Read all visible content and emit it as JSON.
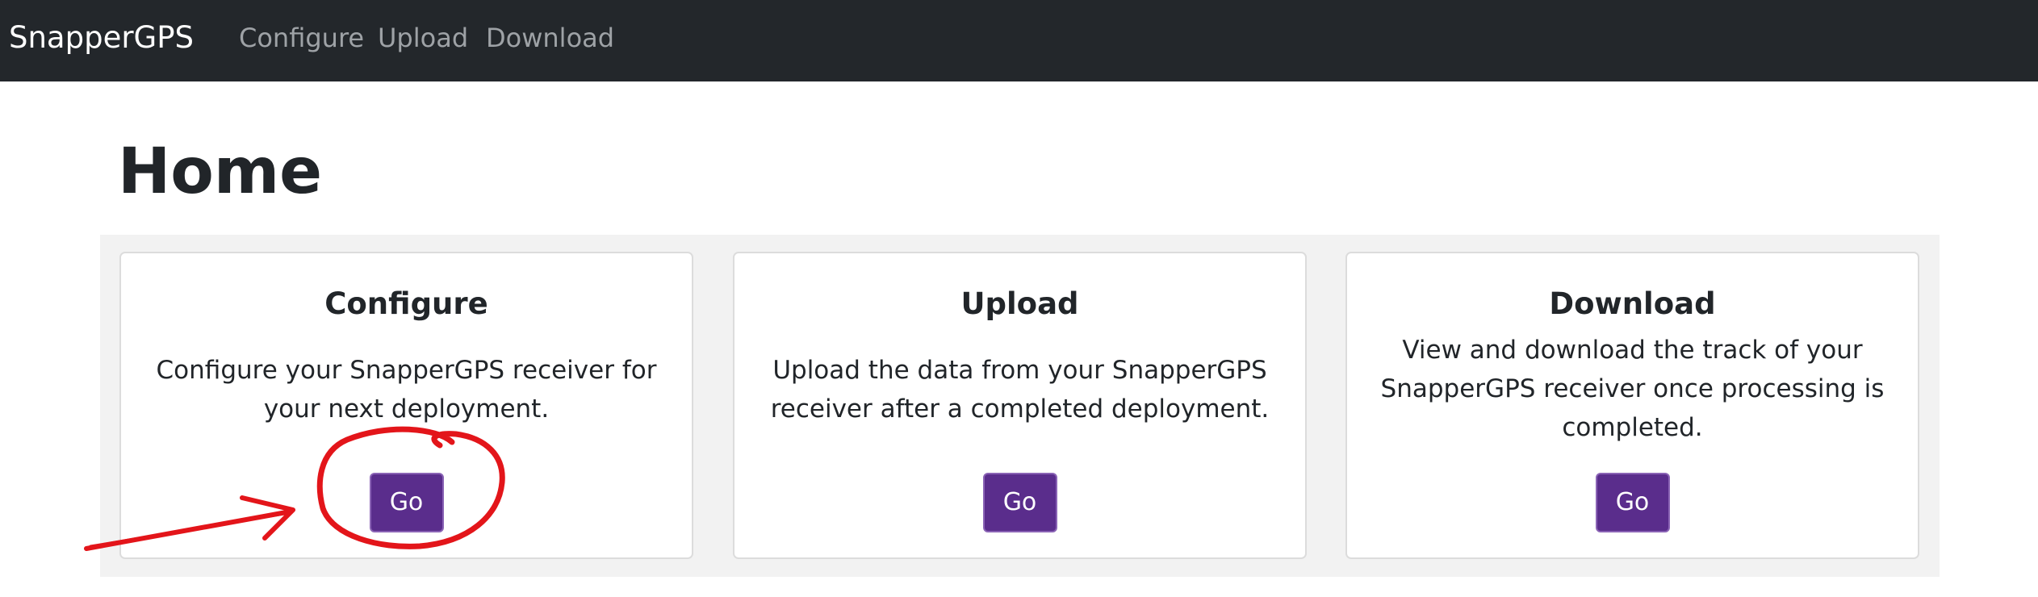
{
  "navbar": {
    "brand": "SnapperGPS",
    "links": [
      {
        "label": "Configure"
      },
      {
        "label": "Upload"
      },
      {
        "label": "Download"
      }
    ]
  },
  "page": {
    "title": "Home"
  },
  "cards": [
    {
      "title": "Configure",
      "text": "Configure your SnapperGPS receiver for your next deployment.",
      "button_label": "Go"
    },
    {
      "title": "Upload",
      "text": "Upload the data from your SnapperGPS receiver after a completed deployment.",
      "button_label": "Go"
    },
    {
      "title": "Download",
      "text": "View and download the track of your SnapperGPS receiver once processing is completed.",
      "button_label": "Go"
    }
  ],
  "colors": {
    "navbar_bg": "#23272b",
    "button_bg": "#5a2d8c",
    "annotation": "#e3151a"
  }
}
